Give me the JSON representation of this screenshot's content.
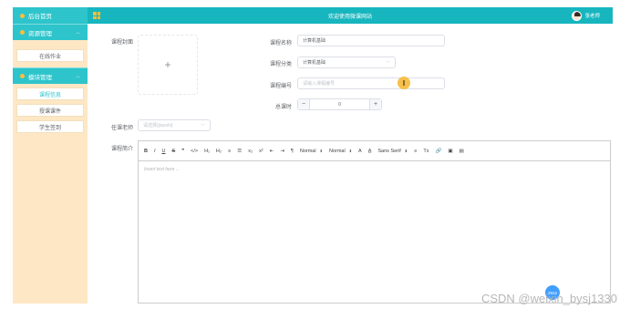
{
  "sidebar": {
    "home": "后台首页",
    "groups": [
      {
        "label": "资源管理",
        "items": [
          "在线作业"
        ]
      },
      {
        "label": "模块管理",
        "items": [
          "课程信息",
          "授课课件",
          "学生签到"
        ]
      }
    ]
  },
  "topbar": {
    "title": "欢迎使用微课网站",
    "username": "张老师"
  },
  "form": {
    "cover_label": "课程封面",
    "upload_plus": "+",
    "name_label": "课程名称",
    "name_value": "计算机基础",
    "category_label": "课程分类",
    "category_value": "计算机基础",
    "code_label": "课程编号",
    "code_placeholder": "请输入课程编号",
    "hours_label": "总课时",
    "hours_value": "0",
    "minus": "−",
    "plus": "+",
    "teacher_label": "任课老师",
    "teacher_placeholder": "请选择(jiaoshi)",
    "intro_label": "课程简介"
  },
  "editor": {
    "toolbar": [
      "B",
      "I",
      "U",
      "S",
      "❞",
      "</>",
      "H₁",
      "H₂",
      "≡",
      "☰",
      "x₂",
      "x²",
      "⇤",
      "⇥",
      "¶",
      "Normal",
      "Normal",
      "A",
      "A̲",
      "Sans Serif",
      "≡",
      "Tx",
      "🔗",
      "▣",
      "▤"
    ],
    "placeholder": "Insert text here ..."
  },
  "cursor_glyph": "I",
  "badge": "2924",
  "watermark": "CSDN @weixin_bysj1330"
}
